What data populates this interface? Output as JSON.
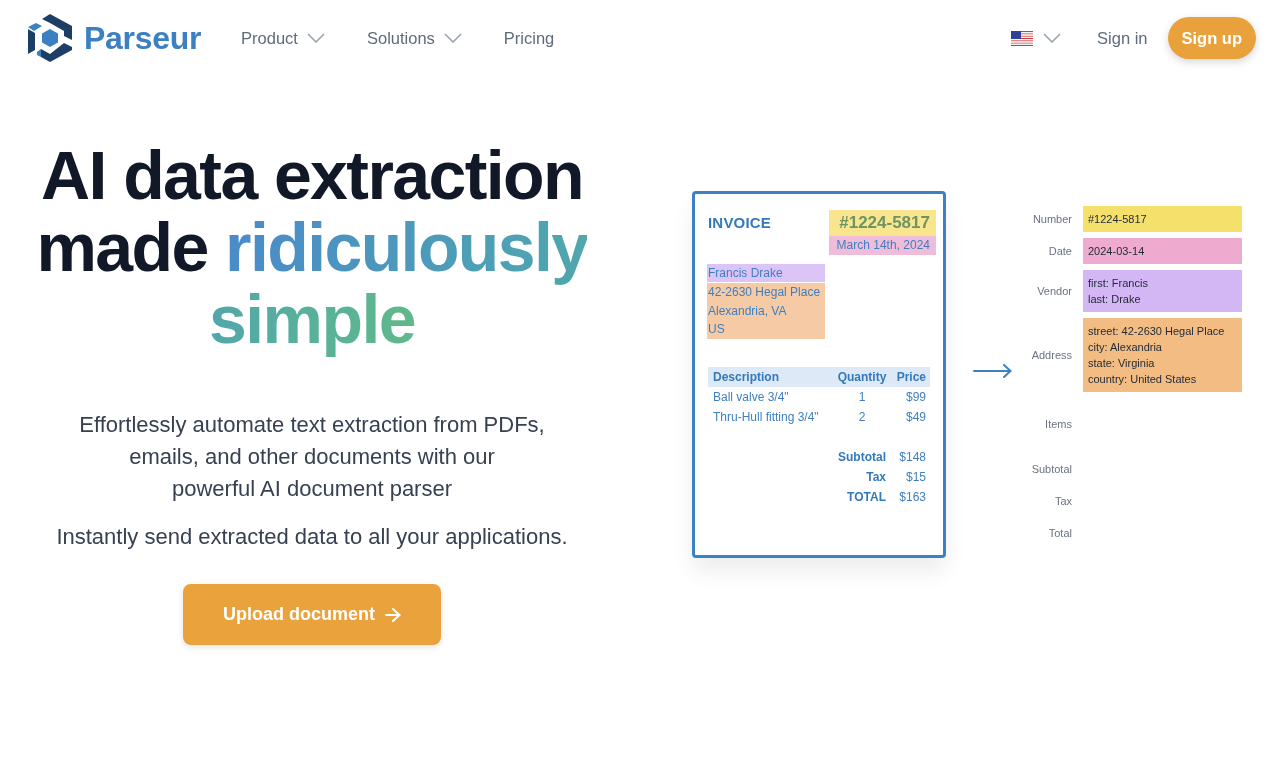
{
  "nav": {
    "logo": "Parseur",
    "links": [
      {
        "label": "Product",
        "dropdown": true
      },
      {
        "label": "Solutions",
        "dropdown": true
      },
      {
        "label": "Pricing",
        "dropdown": false
      }
    ],
    "sign_in": "Sign in",
    "sign_up": "Sign up"
  },
  "hero": {
    "headline": "AI data extraction made",
    "headline_highlight": "ridiculously simple",
    "description": [
      "Effortlessly automate text extraction from PDFs,",
      "emails, and other documents with our",
      "powerful AI document parser"
    ],
    "tagline": "Instantly send extracted data to all your applications.",
    "cta": "Upload document"
  },
  "invoice": {
    "title": "INVOICE",
    "highlights": [
      {
        "kind": "number",
        "lines": [
          "#1224-5817"
        ],
        "color": "#f8e58e"
      },
      {
        "kind": "date",
        "lines": [
          "March 14th, 2024"
        ],
        "color": "#efbcda"
      },
      {
        "kind": "vendor",
        "lines": [
          "Francis Drake"
        ],
        "color": "#dcc5f6"
      },
      {
        "kind": "address",
        "lines": [
          "42-2630 Hegal Place",
          "Alexandria, VA",
          "US"
        ],
        "color": "#f6caa4"
      }
    ],
    "table": {
      "columns": [
        "Description",
        "Quantity",
        "Price"
      ],
      "rows": [
        [
          "Ball valve 3/4\"",
          "1",
          "$99"
        ],
        [
          "Thru-Hull fitting 3/4\"",
          "2",
          "$49"
        ]
      ]
    },
    "totals": [
      {
        "label": "Subtotal",
        "value": "$148"
      },
      {
        "label": "Tax",
        "value": "$15"
      },
      {
        "label": "TOTAL",
        "value": "$163"
      }
    ]
  },
  "extracted_fields": [
    {
      "label": "Number",
      "kind": "text",
      "lines": [
        "#1224-5817"
      ],
      "color": "#f6e06c"
    },
    {
      "label": "Date",
      "kind": "text",
      "lines": [
        "2024-03-14"
      ],
      "color": "#eeabcf"
    },
    {
      "label": "Vendor",
      "kind": "text",
      "lines": [
        "first: Francis",
        "last: Drake"
      ],
      "color": "#d3b6f4"
    },
    {
      "label": "Address",
      "kind": "text",
      "lines": [
        "street: 42-2630 Hegal Place",
        "city: Alexandria",
        "state: Virginia",
        "country: United States"
      ],
      "color": "#f2bc82"
    },
    {
      "label": "Items",
      "kind": "list"
    },
    {
      "label": "Subtotal",
      "kind": "text"
    },
    {
      "label": "Tax",
      "kind": "text"
    },
    {
      "label": "Total",
      "kind": "text"
    }
  ]
}
